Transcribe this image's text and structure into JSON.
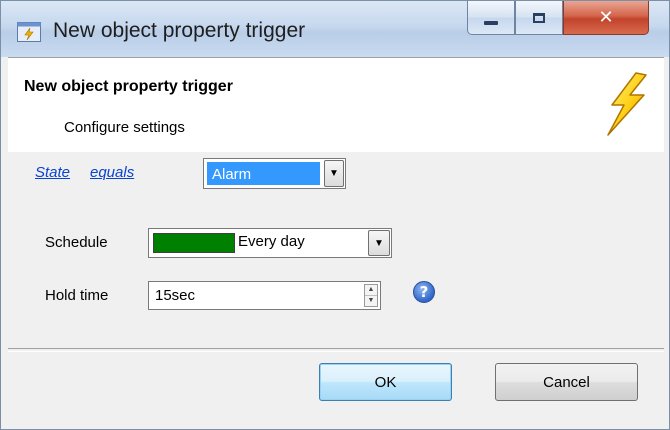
{
  "window": {
    "title": "New object property trigger",
    "controls": {
      "minimize_icon": "minimize-icon",
      "maximize_icon": "maximize-icon",
      "close_icon": "close-icon"
    }
  },
  "header": {
    "title": "New object property trigger",
    "subtitle": "Configure settings",
    "icon": "lightning-icon"
  },
  "form": {
    "condition": {
      "property_link": "State",
      "operator_link": "equals",
      "value": "Alarm"
    },
    "schedule": {
      "label": "Schedule",
      "value": "Every day",
      "color": "#008000"
    },
    "hold_time": {
      "label": "Hold time",
      "value": "15sec"
    },
    "help_icon": "help-icon"
  },
  "buttons": {
    "ok": "OK",
    "cancel": "Cancel"
  },
  "colors": {
    "selection": "#3399ff",
    "link": "#0a43d0",
    "close_button": "#c2442b"
  }
}
